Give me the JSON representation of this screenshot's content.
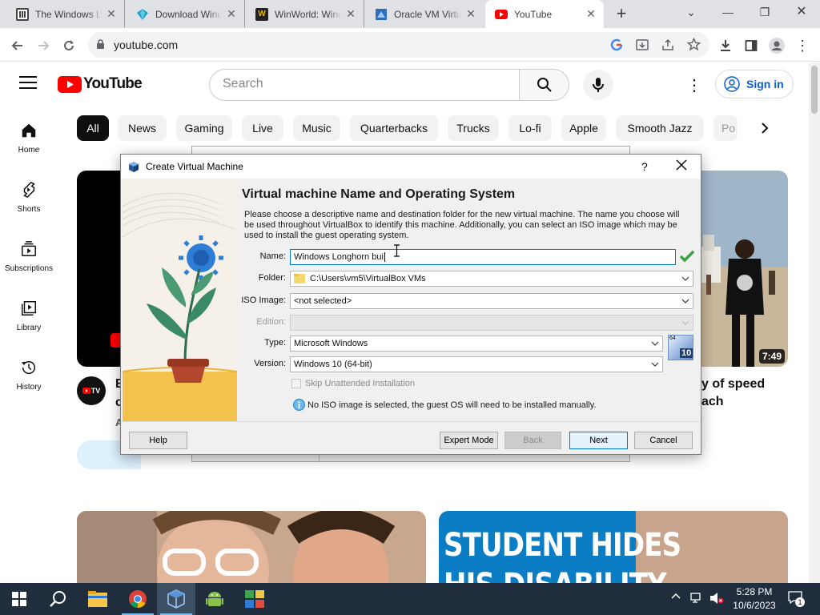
{
  "browser": {
    "tabs": [
      {
        "title": "The Windows Longhorn",
        "favicon": "archive-icon",
        "active": false
      },
      {
        "title": "Download Windows",
        "favicon": "diamond-icon",
        "active": false
      },
      {
        "title": "WinWorld: Windows",
        "favicon": "winworld-icon",
        "active": false
      },
      {
        "title": "Oracle VM VirtualBox",
        "favicon": "virtualbox-icon",
        "active": false
      },
      {
        "title": "YouTube",
        "favicon": "youtube-icon",
        "active": true
      }
    ],
    "url": "youtube.com"
  },
  "youtube": {
    "logo_text": "YouTube",
    "search_placeholder": "Search",
    "signin_label": "Sign in",
    "sidebar": [
      {
        "label": "Home",
        "icon": "home-icon"
      },
      {
        "label": "Shorts",
        "icon": "shorts-icon"
      },
      {
        "label": "Subscriptions",
        "icon": "subscriptions-icon"
      },
      {
        "label": "Library",
        "icon": "library-icon"
      },
      {
        "label": "History",
        "icon": "history-icon"
      }
    ],
    "chips": [
      "All",
      "News",
      "Gaming",
      "Live",
      "Music",
      "Quarterbacks",
      "Trucks",
      "Lo-fi",
      "Apple",
      "Smooth Jazz",
      "Po"
    ],
    "videos": {
      "right_duration": "7:49",
      "right_title_line1": "y of speed",
      "right_title_line2": "ach",
      "left_channel_badge": "TV",
      "left_title_initial": "E",
      "left_title_line2": "c",
      "left_meta": "A",
      "bottom_right_caption_line1": "STUDENT HIDES",
      "bottom_right_caption_line2": "HIS DISABILITY"
    }
  },
  "dialog": {
    "title": "Create Virtual Machine",
    "help_glyph": "?",
    "heading": "Virtual machine Name and Operating System",
    "description": "Please choose a descriptive name and destination folder for the new virtual machine. The name you choose will be used throughout VirtualBox to identify this machine. Additionally, you can select an ISO image which may be used to install the guest operating system.",
    "name_label": "Name:",
    "name_value": "Windows Longhorn bui",
    "folder_label": "Folder:",
    "folder_value": "C:\\Users\\vm5\\VirtualBox VMs",
    "iso_label": "ISO Image:",
    "iso_value": "<not selected>",
    "edition_label": "Edition:",
    "edition_value": "",
    "type_label": "Type:",
    "type_value": "Microsoft Windows",
    "version_label": "Version:",
    "version_value": "Windows 10 (64-bit)",
    "os_badge_top": "64",
    "os_badge_bottom": "10",
    "skip_label": "Skip Unattended Installation",
    "skip_checked": false,
    "info_text": "No ISO image is selected, the guest OS will need to be installed manually.",
    "buttons": {
      "help": "Help",
      "expert": "Expert Mode",
      "back": "Back",
      "next": "Next",
      "cancel": "Cancel"
    }
  },
  "taskbar": {
    "time": "5:28 PM",
    "date": "10/6/2023",
    "notification_count": "1"
  },
  "colors": {
    "youtube_red": "#ff0000",
    "link_blue": "#065fd4",
    "taskbar": "#1f2d3d",
    "dialog_bg": "#f0f0f0",
    "accent_green": "#3cb371"
  }
}
